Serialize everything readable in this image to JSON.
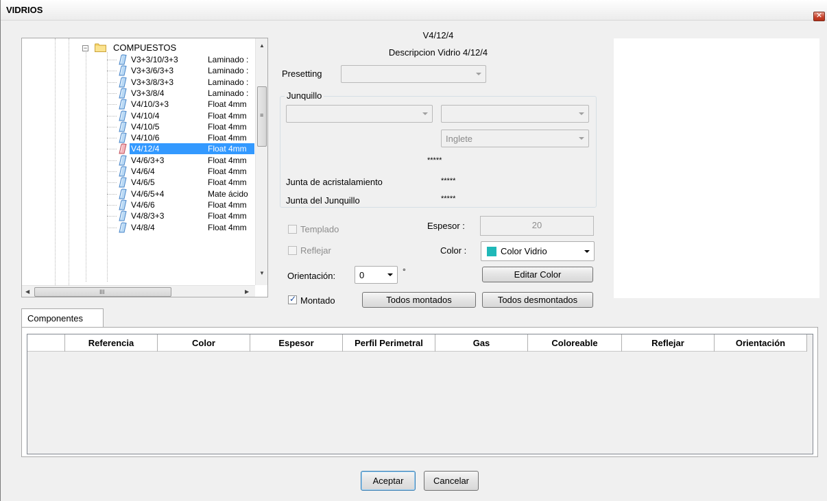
{
  "window": {
    "title": "VIDRIOS"
  },
  "tree": {
    "folder_label": "COMPUESTOS",
    "items": [
      {
        "name": "V3+3/10/3+3",
        "desc": "Laminado :",
        "selected": false
      },
      {
        "name": "V3+3/6/3+3",
        "desc": "Laminado :",
        "selected": false
      },
      {
        "name": "V3+3/8/3+3",
        "desc": "Laminado :",
        "selected": false
      },
      {
        "name": "V3+3/8/4",
        "desc": "Laminado :",
        "selected": false
      },
      {
        "name": "V4/10/3+3",
        "desc": "Float 4mm",
        "selected": false
      },
      {
        "name": "V4/10/4",
        "desc": "Float 4mm",
        "selected": false
      },
      {
        "name": "V4/10/5",
        "desc": "Float 4mm",
        "selected": false
      },
      {
        "name": "V4/10/6",
        "desc": "Float 4mm",
        "selected": false
      },
      {
        "name": "V4/12/4",
        "desc": "Float 4mm",
        "selected": true
      },
      {
        "name": "V4/6/3+3",
        "desc": "Float 4mm",
        "selected": false
      },
      {
        "name": "V4/6/4",
        "desc": "Float 4mm",
        "selected": false
      },
      {
        "name": "V4/6/5",
        "desc": "Float 4mm",
        "selected": false
      },
      {
        "name": "V4/6/5+4",
        "desc": "Mate ácido",
        "selected": false
      },
      {
        "name": "V4/6/6",
        "desc": "Float 4mm",
        "selected": false
      },
      {
        "name": "V4/8/3+3",
        "desc": "Float 4mm",
        "selected": false
      },
      {
        "name": "V4/8/4",
        "desc": "Float 4mm",
        "selected": false
      }
    ],
    "hscroll_grip": "III"
  },
  "detail": {
    "code": "V4/12/4",
    "description": "Descripcion Vidrio 4/12/4",
    "presetting_label": "Presetting",
    "presetting_value": "",
    "junquillo": {
      "title": "Junquillo",
      "combo1_value": "",
      "combo2_value": "",
      "inglete_value": "Inglete",
      "stars_1": "*****",
      "junta_acristalamiento_label": "Junta de acristalamiento",
      "junta_acristalamiento_value": "*****",
      "junta_junquillo_label": "Junta del Junquillo",
      "junta_junquillo_value": "*****"
    },
    "templado_label": "Templado",
    "reflejar_label": "Reflejar",
    "espesor_label": "Espesor :",
    "espesor_value": "20",
    "color_label": "Color :",
    "color_value": "Color Vidrio",
    "color_swatch": "#1fb8b8",
    "orientacion_label": "Orientación:",
    "orientacion_value": "0",
    "degree_symbol": "°",
    "editar_color_label": "Editar Color",
    "montado_label": "Montado",
    "montado_checked": true,
    "todos_montados_label": "Todos montados",
    "todos_desmontados_label": "Todos desmontados"
  },
  "components": {
    "tab_label": "Componentes",
    "columns": [
      "Referencia",
      "Color",
      "Espesor",
      "Perfil Perimetral",
      "Gas",
      "Coloreable",
      "Reflejar",
      "Orientación"
    ],
    "rows": []
  },
  "footer": {
    "aceptar_label": "Aceptar",
    "cancelar_label": "Cancelar"
  }
}
